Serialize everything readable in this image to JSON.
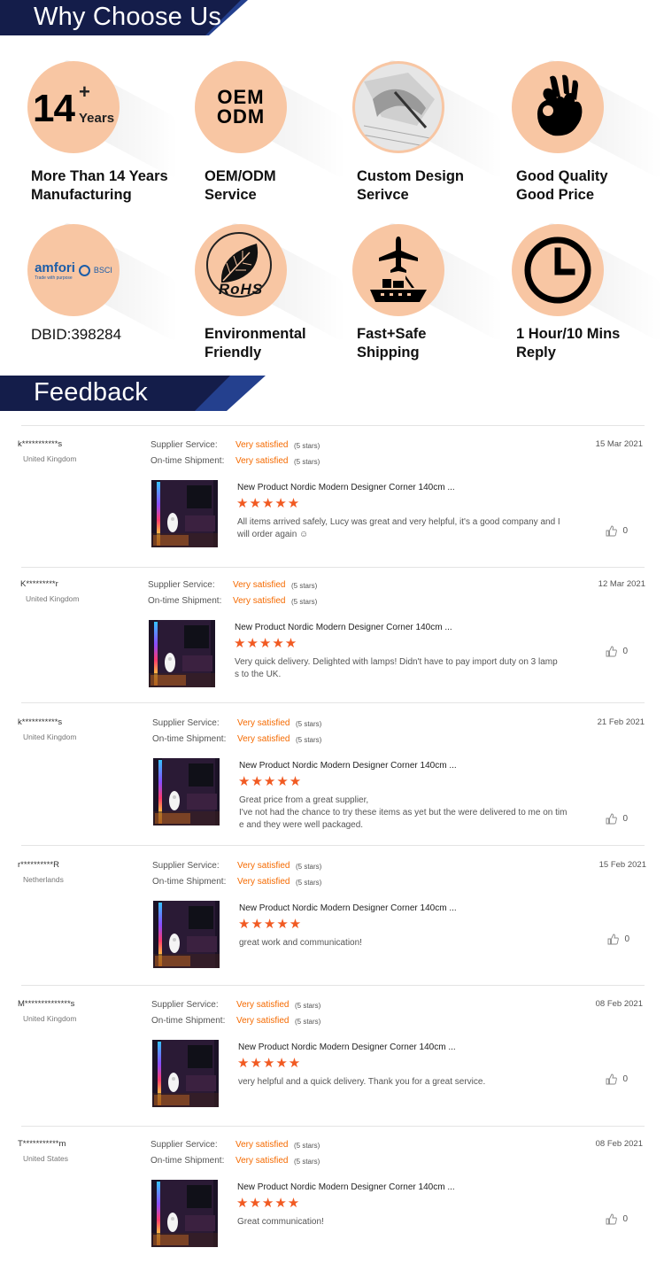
{
  "sections": {
    "why_title": "Why Choose Us",
    "feedback_title": "Feedback"
  },
  "features": [
    {
      "icon": "years-badge-icon",
      "big": "14",
      "plus": "+",
      "small": "Years",
      "text": "More Than 14 Years\nManufacturing"
    },
    {
      "icon": "oem-odm-icon",
      "line1": "OEM",
      "line2": "ODM",
      "text": "OEM/ODM\nService"
    },
    {
      "icon": "drafting-hand-icon",
      "text": "Custom Design\nSerivce"
    },
    {
      "icon": "ok-hand-icon",
      "text": "Good Quality\nGood Price"
    },
    {
      "icon": "amfori-bsci-logo",
      "brand": "amfori",
      "brand2": "BSCI",
      "tagline": "Trade with purpose",
      "text": "DBID:398284"
    },
    {
      "icon": "rohs-leaf-icon",
      "rohs": "RoHS",
      "text": "Environmental\nFriendly"
    },
    {
      "icon": "plane-ship-icon",
      "text": "Fast+Safe\nShipping"
    },
    {
      "icon": "clock-icon",
      "text": "1 Hour/10 Mins\nReply"
    }
  ],
  "review_labels": {
    "supplier": "Supplier Service:",
    "shipment": "On-time Shipment:",
    "value": "Very satisfied",
    "stars": "(5 stars)",
    "rating": "★★★★★"
  },
  "reviews": [
    {
      "user": "k***********s",
      "country": "United Kingdom",
      "date": "15 Mar 2021",
      "product": "New Product Nordic Modern Designer Corner 140cm ...",
      "comment": "All items arrived safely, Lucy was great and very helpful, it's a good company and I\nwill order again ☺",
      "likes": "0"
    },
    {
      "user": "K*********r",
      "country": "United Kingdom",
      "date": "12 Mar 2021",
      "product": "New Product Nordic Modern Designer Corner 140cm ...",
      "comment": "Very quick delivery. Delighted with lamps! Didn't have to pay import duty on 3 lamp\ns to the UK.",
      "likes": "0"
    },
    {
      "user": "k***********s",
      "country": "United Kingdom",
      "date": "21 Feb 2021",
      "product": "New Product Nordic Modern Designer Corner 140cm ...",
      "comment": "Great price from a great supplier,\nI've not had the chance to try these items as yet but the were delivered to me on tim\ne and they were well packaged.",
      "likes": "0"
    },
    {
      "user": "r**********R",
      "country": "Netherlands",
      "date": "15 Feb 2021",
      "product": "New Product Nordic Modern Designer Corner 140cm ...",
      "comment": "great work and communication!",
      "likes": "0"
    },
    {
      "user": "M**************s",
      "country": "United Kingdom",
      "date": "08 Feb 2021",
      "product": "New Product Nordic Modern Designer Corner 140cm ...",
      "comment": "very helpful and a quick delivery. Thank you for a great service.",
      "likes": "0"
    },
    {
      "user": "T***********m",
      "country": "United States",
      "date": "08 Feb 2021",
      "product": "New Product Nordic Modern Designer Corner 140cm ...",
      "comment": "Great communication!",
      "likes": "0"
    }
  ]
}
